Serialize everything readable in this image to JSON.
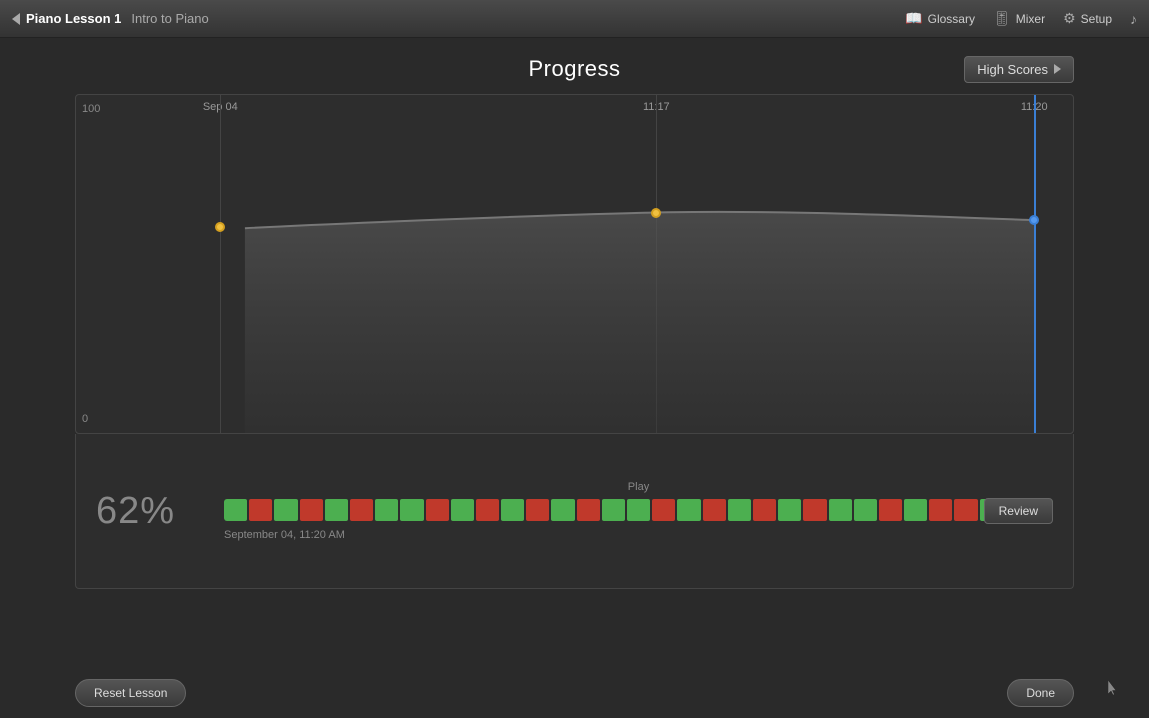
{
  "app": {
    "title": "Piano Lesson 1",
    "subtitle": "Intro to Piano"
  },
  "topbar": {
    "glossary_label": "Glossary",
    "mixer_label": "Mixer",
    "setup_label": "Setup"
  },
  "page": {
    "title": "Progress",
    "high_scores_label": "High Scores"
  },
  "chart": {
    "y_max": "100",
    "y_min": "0",
    "dates": [
      "Sep 04",
      "11:17",
      "11:20"
    ],
    "data_points": [
      {
        "label": "Sep 04 point",
        "score": 62,
        "x_pct": 12
      },
      {
        "label": "11:17 point",
        "score": 66,
        "x_pct": 57
      },
      {
        "label": "11:20 point",
        "score": 64,
        "x_pct": 96
      }
    ]
  },
  "bottom": {
    "score": "62",
    "score_suffix": "%",
    "play_label": "Play",
    "date_label": "September 04, 11:20 AM",
    "review_label": "Review"
  },
  "footer": {
    "reset_label": "Reset Lesson",
    "done_label": "Done"
  },
  "segments": [
    "green",
    "red",
    "green",
    "red",
    "green",
    "red",
    "green",
    "green",
    "red",
    "green",
    "red",
    "green",
    "red",
    "green",
    "red",
    "green",
    "green",
    "red",
    "green",
    "red",
    "green",
    "red",
    "green",
    "red",
    "green",
    "green",
    "red",
    "green",
    "red",
    "red",
    "green",
    "red",
    "green"
  ]
}
